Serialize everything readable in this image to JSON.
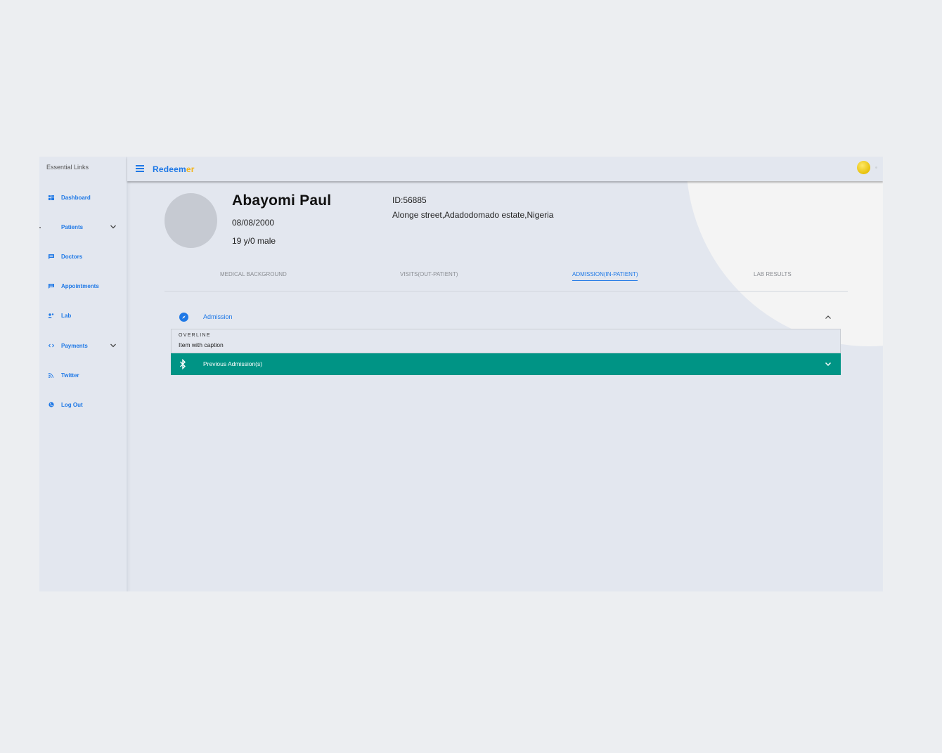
{
  "sidebar": {
    "header": "Essential Links",
    "items": [
      {
        "label": "Dashboard",
        "icon": "dashboard-icon",
        "expandable": false
      },
      {
        "label": "Patients",
        "icon": "none",
        "expandable": true
      },
      {
        "label": "Doctors",
        "icon": "chat-icon",
        "expandable": false
      },
      {
        "label": "Appointments",
        "icon": "calendar-icon",
        "expandable": false
      },
      {
        "label": "Lab",
        "icon": "group-icon",
        "expandable": false
      },
      {
        "label": "Payments",
        "icon": "code-icon",
        "expandable": true
      },
      {
        "label": "Twitter",
        "icon": "rss-icon",
        "expandable": false
      },
      {
        "label": "Log Out",
        "icon": "globe-icon",
        "expandable": false
      }
    ]
  },
  "topbar": {
    "brand_main": "Redeem",
    "brand_accent": "er"
  },
  "patient": {
    "name": "Abayomi Paul",
    "dob": "08/08/2000",
    "age_sex": "19 y/0 male",
    "id": "ID:56885",
    "address": "Alonge street,Adadodomado estate,Nigeria"
  },
  "tabs": [
    {
      "label": "MEDICAL BACKGROUND",
      "active": false
    },
    {
      "label": "VISITS(OUT-PATIENT)",
      "active": false
    },
    {
      "label": "ADMISSION(IN-PATIENT)",
      "active": true
    },
    {
      "label": "LAB RESULTS",
      "active": false
    }
  ],
  "admission_panel": {
    "title": "Admission",
    "overline": "OVERLINE",
    "caption": "Item with caption"
  },
  "previous_panel": {
    "title": "Previous Admission(s)"
  },
  "colors": {
    "accent": "#1e78e6",
    "brand_accent": "#f2b51c",
    "teal": "#009485",
    "background": "#e3e7ef"
  }
}
